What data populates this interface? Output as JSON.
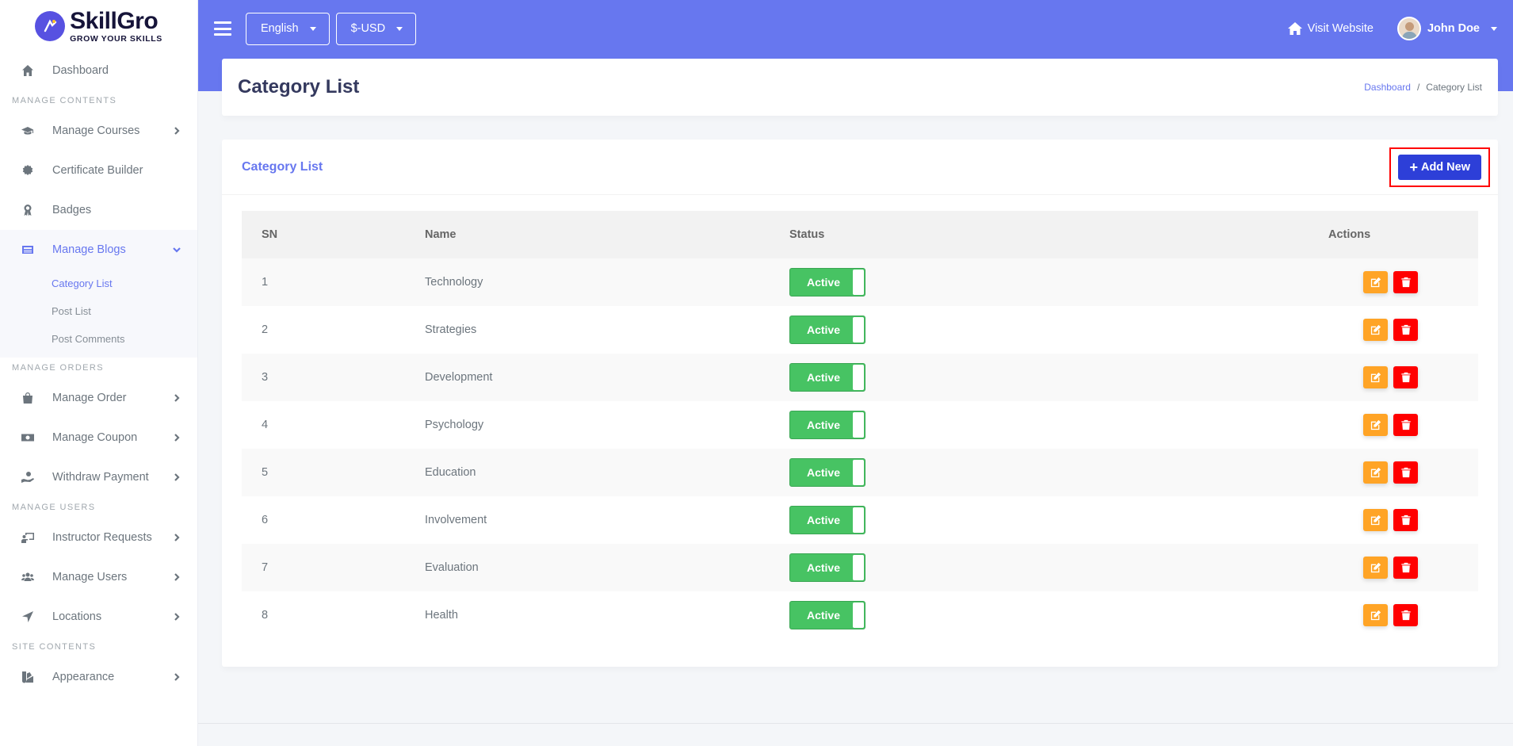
{
  "brand": {
    "name": "SkillGro",
    "tagline": "GROW YOUR SKILLS"
  },
  "sidebar": {
    "dashboard": "Dashboard",
    "section_contents": "MANAGE CONTENTS",
    "manage_courses": "Manage Courses",
    "certificate_builder": "Certificate Builder",
    "badges": "Badges",
    "manage_blogs": "Manage Blogs",
    "sub_category_list": "Category List",
    "sub_post_list": "Post List",
    "sub_post_comments": "Post Comments",
    "section_orders": "MANAGE ORDERS",
    "manage_order": "Manage Order",
    "manage_coupon": "Manage Coupon",
    "withdraw_payment": "Withdraw Payment",
    "section_users": "MANAGE USERS",
    "instructor_requests": "Instructor Requests",
    "manage_users": "Manage Users",
    "locations": "Locations",
    "section_site": "SITE CONTENTS",
    "appearance": "Appearance"
  },
  "navbar": {
    "language": "English",
    "currency": "$-USD",
    "visit_website": "Visit Website",
    "user_name": "John Doe"
  },
  "page": {
    "title": "Category List",
    "breadcrumb_home": "Dashboard",
    "breadcrumb_sep": "/",
    "breadcrumb_current": "Category List"
  },
  "card": {
    "title": "Category List",
    "add_new": "Add New"
  },
  "table": {
    "headers": {
      "sn": "SN",
      "name": "Name",
      "status": "Status",
      "actions": "Actions"
    },
    "rows": [
      {
        "sn": "1",
        "name": "Technology",
        "status": "Active"
      },
      {
        "sn": "2",
        "name": "Strategies",
        "status": "Active"
      },
      {
        "sn": "3",
        "name": "Development",
        "status": "Active"
      },
      {
        "sn": "4",
        "name": "Psychology",
        "status": "Active"
      },
      {
        "sn": "5",
        "name": "Education",
        "status": "Active"
      },
      {
        "sn": "6",
        "name": "Involvement",
        "status": "Active"
      },
      {
        "sn": "7",
        "name": "Evaluation",
        "status": "Active"
      },
      {
        "sn": "8",
        "name": "Health",
        "status": "Active"
      }
    ]
  },
  "colors": {
    "primary": "#6777ef",
    "add_button": "#2d3fd8",
    "active_toggle": "#47c363",
    "edit": "#ffa426",
    "delete": "#ff0000"
  },
  "icons": {
    "dashboard": "home-icon",
    "courses": "graduation-cap-icon",
    "certificate": "certificate-icon",
    "badges": "award-icon",
    "blogs": "newspaper-icon",
    "order": "shopping-bag-icon",
    "coupon": "money-bill-icon",
    "withdraw": "hand-holding-dollar-icon",
    "instructor": "chalkboard-teacher-icon",
    "users": "users-icon",
    "locations": "location-arrow-icon",
    "appearance": "swatchbook-icon",
    "edit": "edit-icon",
    "delete": "trash-icon"
  }
}
